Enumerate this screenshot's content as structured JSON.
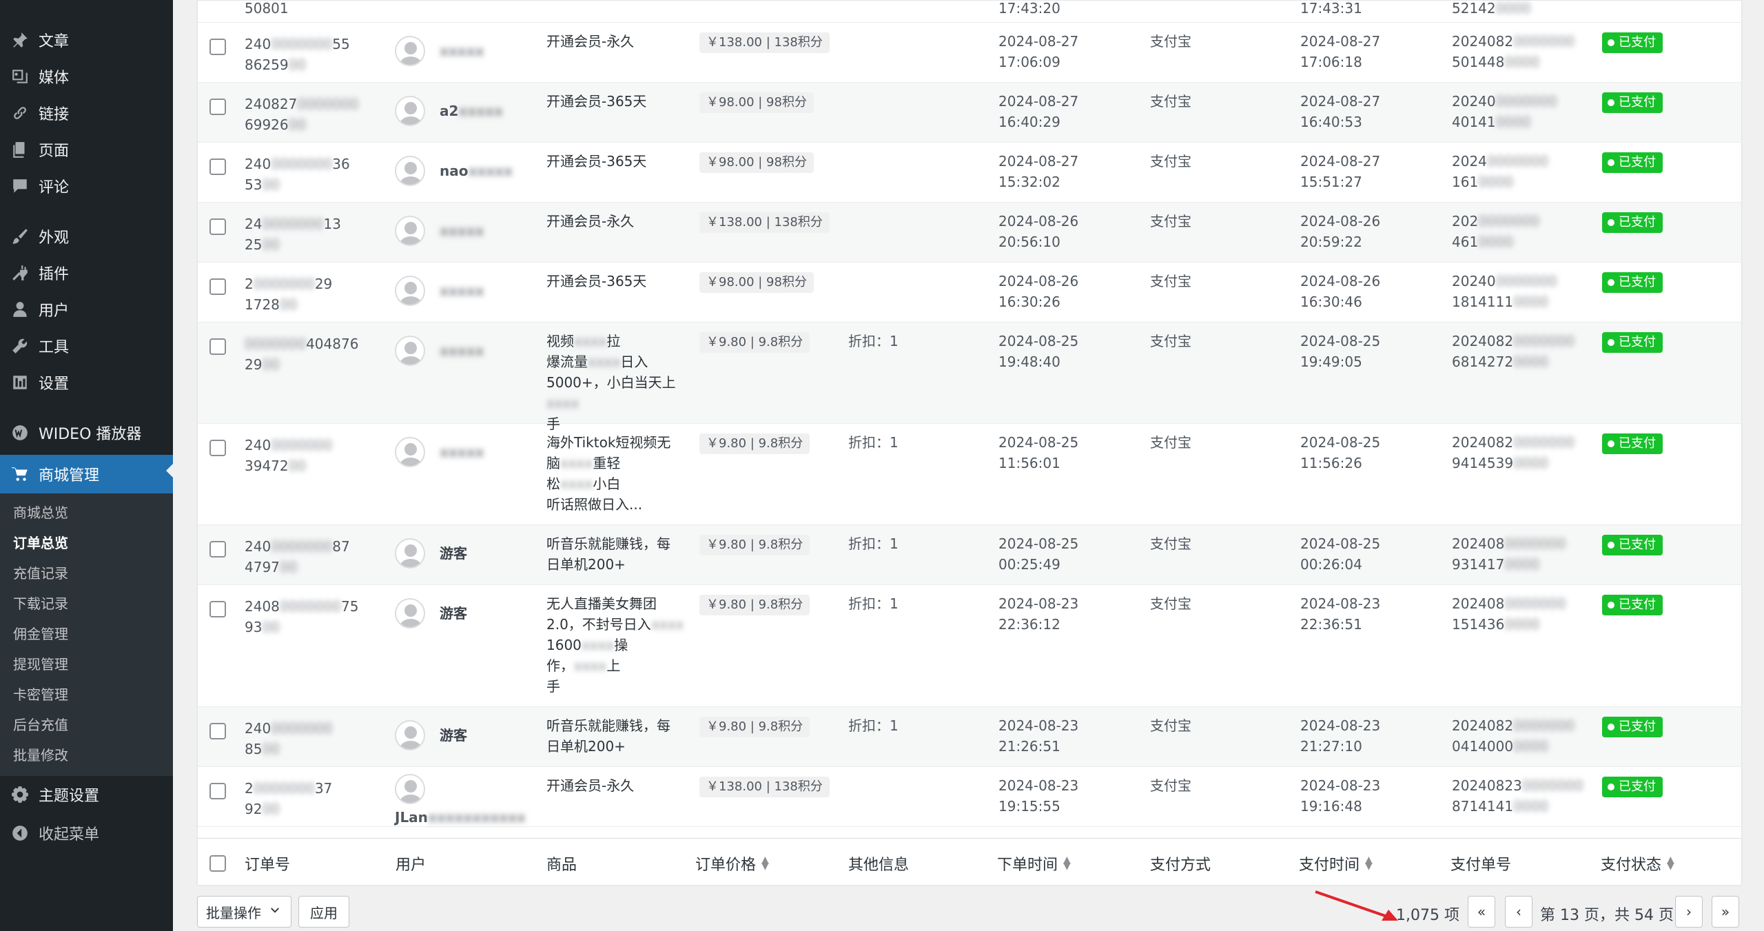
{
  "sidebar": {
    "items": [
      {
        "label": "文章",
        "icon": "pin-icon"
      },
      {
        "label": "媒体",
        "icon": "media-icon"
      },
      {
        "label": "链接",
        "icon": "link-icon"
      },
      {
        "label": "页面",
        "icon": "page-icon"
      },
      {
        "label": "评论",
        "icon": "comment-icon"
      },
      {
        "label": "外观",
        "icon": "brush-icon"
      },
      {
        "label": "插件",
        "icon": "plugin-icon"
      },
      {
        "label": "用户",
        "icon": "user-icon"
      },
      {
        "label": "工具",
        "icon": "wrench-icon"
      },
      {
        "label": "设置",
        "icon": "settings-icon"
      },
      {
        "label": "WIDEO 播放器",
        "icon": "wideo-icon"
      },
      {
        "label": "商城管理",
        "icon": "cart-icon",
        "active": true
      }
    ],
    "submenu": [
      "商城总览",
      "订单总览",
      "充值记录",
      "下载记录",
      "佣金管理",
      "提现管理",
      "卡密管理",
      "后台充值",
      "批量修改"
    ],
    "submenu_current": "订单总览",
    "bottom_items": [
      {
        "label": "主题设置",
        "icon": "gear-icon"
      },
      {
        "label": "收起菜单",
        "icon": "collapse-icon"
      }
    ]
  },
  "table": {
    "columns": [
      "订单号",
      "用户",
      "商品",
      "订单价格",
      "其他信息",
      "下单时间",
      "支付方式",
      "支付时间",
      "支付单号",
      "支付状态"
    ],
    "top_partial_row": {
      "order_tail": "50801",
      "order_time_tail": "17:43:20",
      "pay_time_tail": "17:43:31",
      "pay_no_head": "52142"
    },
    "rows": [
      {
        "order_lines": [
          "240",
          "86259"
        ],
        "order_suffix": "55",
        "user": "",
        "product": [
          "开通会员-永久"
        ],
        "price": "￥138.00 | 138积分",
        "other": "",
        "order_date": "2024-08-27",
        "order_clock": "17:06:09",
        "pay_method": "支付宝",
        "pay_date": "2024-08-27",
        "pay_clock": "17:06:18",
        "pay_no": [
          "2024082",
          "501448"
        ],
        "status": "已支付"
      },
      {
        "order_lines": [
          "240827",
          "69926"
        ],
        "order_suffix": "",
        "user": "a2",
        "product": [
          "开通会员-365天"
        ],
        "price": "￥98.00 | 98积分",
        "other": "",
        "order_date": "2024-08-27",
        "order_clock": "16:40:29",
        "pay_method": "支付宝",
        "pay_date": "2024-08-27",
        "pay_clock": "16:40:53",
        "pay_no": [
          "20240",
          "40141"
        ],
        "status": "已支付"
      },
      {
        "order_lines": [
          "240",
          "53"
        ],
        "order_suffix": "36",
        "user": "nao",
        "product": [
          "开通会员-365天"
        ],
        "price": "￥98.00 | 98积分",
        "other": "",
        "order_date": "2024-08-27",
        "order_clock": "15:32:02",
        "pay_method": "支付宝",
        "pay_date": "2024-08-27",
        "pay_clock": "15:51:27",
        "pay_no": [
          "2024",
          "161"
        ],
        "status": "已支付"
      },
      {
        "order_lines": [
          "24",
          "25"
        ],
        "order_suffix": "13",
        "user": "",
        "product": [
          "开通会员-永久"
        ],
        "price": "￥138.00 | 138积分",
        "other": "",
        "order_date": "2024-08-26",
        "order_clock": "20:56:10",
        "pay_method": "支付宝",
        "pay_date": "2024-08-26",
        "pay_clock": "20:59:22",
        "pay_no": [
          "202",
          "461"
        ],
        "status": "已支付"
      },
      {
        "order_lines": [
          "2",
          "1728"
        ],
        "order_suffix": "29",
        "user": "",
        "product": [
          "开通会员-365天"
        ],
        "price": "￥98.00 | 98积分",
        "other": "",
        "order_date": "2024-08-26",
        "order_clock": "16:30:26",
        "pay_method": "支付宝",
        "pay_date": "2024-08-26",
        "pay_clock": "16:30:46",
        "pay_no": [
          "20240",
          "1814111"
        ],
        "status": "已支付"
      },
      {
        "order_lines": [
          "",
          "29"
        ],
        "order_suffix": "404876",
        "user": "",
        "product": [
          "视频",
          "爆流量",
          "5000+，小白当天上",
          "手"
        ],
        "product_tails": [
          "拉",
          "日入",
          "",
          ""
        ],
        "price": "￥9.80 | 9.8积分",
        "other": "折扣：1",
        "order_date": "2024-08-25",
        "order_clock": "19:48:40",
        "pay_method": "支付宝",
        "pay_date": "2024-08-25",
        "pay_clock": "19:49:05",
        "pay_no": [
          "2024082",
          "6814272"
        ],
        "status": "已支付"
      },
      {
        "order_lines": [
          "240",
          "39472"
        ],
        "order_suffix": "",
        "user": "",
        "product": [
          "海外Tiktok短视频无",
          "脑",
          "松",
          "听话照做日入..."
        ],
        "product_tails": [
          "",
          "重轻",
          "小白",
          ""
        ],
        "price": "￥9.80 | 9.8积分",
        "other": "折扣：1",
        "order_date": "2024-08-25",
        "order_clock": "11:56:01",
        "pay_method": "支付宝",
        "pay_date": "2024-08-25",
        "pay_clock": "11:56:26",
        "pay_no": [
          "2024082",
          "9414539"
        ],
        "status": "已支付"
      },
      {
        "order_lines": [
          "240",
          "4797"
        ],
        "order_suffix": "87",
        "user": "游客",
        "product": [
          "听音乐就能赚钱，每",
          "日单机200+"
        ],
        "price": "￥9.80 | 9.8积分",
        "other": "折扣：1",
        "order_date": "2024-08-25",
        "order_clock": "00:25:49",
        "pay_method": "支付宝",
        "pay_date": "2024-08-25",
        "pay_clock": "00:26:04",
        "pay_no": [
          "202408",
          "931417"
        ],
        "status": "已支付"
      },
      {
        "order_lines": [
          "2408",
          "93"
        ],
        "order_suffix": "75",
        "user": "游客",
        "product": [
          "无人直播美女舞团",
          "2.0，不封号日入",
          "1600",
          "作，",
          "手"
        ],
        "product_tails": [
          "",
          "",
          "操",
          "上",
          ""
        ],
        "price": "￥9.80 | 9.8积分",
        "other": "折扣：1",
        "order_date": "2024-08-23",
        "order_clock": "22:36:12",
        "pay_method": "支付宝",
        "pay_date": "2024-08-23",
        "pay_clock": "22:36:51",
        "pay_no": [
          "202408",
          "151436"
        ],
        "status": "已支付"
      },
      {
        "order_lines": [
          "240",
          "85"
        ],
        "order_suffix": "",
        "user": "游客",
        "product": [
          "听音乐就能赚钱，每",
          "日单机200+"
        ],
        "price": "￥9.80 | 9.8积分",
        "other": "折扣：1",
        "order_date": "2024-08-23",
        "order_clock": "21:26:51",
        "pay_method": "支付宝",
        "pay_date": "2024-08-23",
        "pay_clock": "21:27:10",
        "pay_no": [
          "2024082",
          "0414000"
        ],
        "status": "已支付"
      },
      {
        "order_lines": [
          "2",
          "92"
        ],
        "order_suffix": "37",
        "user": "JLan",
        "product": [
          "开通会员-永久"
        ],
        "price": "￥138.00 | 138积分",
        "other": "",
        "order_date": "2024-08-23",
        "order_clock": "19:15:55",
        "pay_method": "支付宝",
        "pay_date": "2024-08-23",
        "pay_clock": "19:16:48",
        "pay_no": [
          "20240823",
          "8714141"
        ],
        "status": "已支付"
      }
    ]
  },
  "pagination": {
    "bulk_action": "批量操作",
    "apply": "应用",
    "total_items": "1,075 项",
    "first": "«",
    "prev": "‹",
    "page_text": "第 13 页，共 54 页",
    "next": "›",
    "last": "»"
  },
  "colors": {
    "sidebar_bg": "#1d2327",
    "active_menu": "#2271b1",
    "paid_badge": "#17c12b",
    "arrow": "#e0252b"
  }
}
